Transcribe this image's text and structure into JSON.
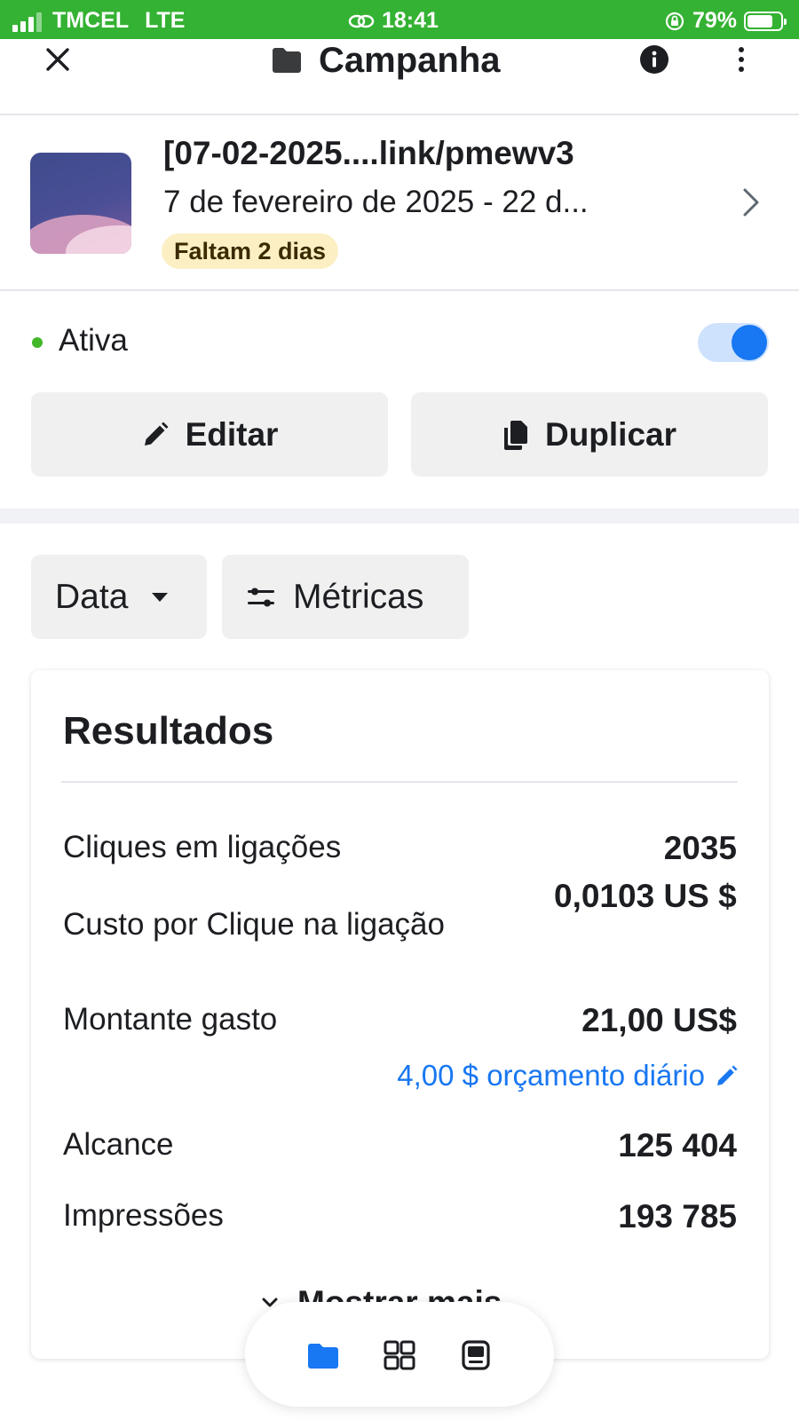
{
  "status_bar": {
    "carrier": "TMCEL",
    "network": "LTE",
    "time": "18:41",
    "battery": "79%",
    "battery_level": 0.79
  },
  "header": {
    "title": "Campanha",
    "icons": [
      "close-icon",
      "folder-icon",
      "info-icon",
      "more-vertical-icon"
    ]
  },
  "campaign": {
    "name": "[07-02-2025....link/pmewv3",
    "date_range": "7 de fevereiro de 2025 - 22 d...",
    "badge": "Faltam 2 dias"
  },
  "status": {
    "label": "Ativa",
    "enabled": true,
    "dot_color": "#42b72a"
  },
  "actions": {
    "edit_label": "Editar",
    "duplicate_label": "Duplicar"
  },
  "filters": {
    "date_label": "Data",
    "metrics_label": "Métricas"
  },
  "results": {
    "title": "Resultados",
    "rows": [
      {
        "label": "Cliques em ligações",
        "value": "2035"
      },
      {
        "label": "Custo por Clique na ligação",
        "value": "0,0103 US $"
      },
      {
        "label": "Montante gasto",
        "value": "21,00 US$"
      },
      {
        "label": "Alcance",
        "value": "125 404"
      },
      {
        "label": "Impressões",
        "value": "193 785"
      }
    ],
    "budget_link": "4,00 $ orçamento diário",
    "show_more": "Mostrar mais"
  },
  "tab_bar": {
    "tabs": [
      "campaigns-folder-icon",
      "grid-icon",
      "ads-icon"
    ],
    "active": "campaigns-folder-icon"
  },
  "colors": {
    "status_bar": "#34b233",
    "accent": "#1877f2",
    "badge_bg": "#fcefc4",
    "chip_bg": "#f0f0f0"
  }
}
